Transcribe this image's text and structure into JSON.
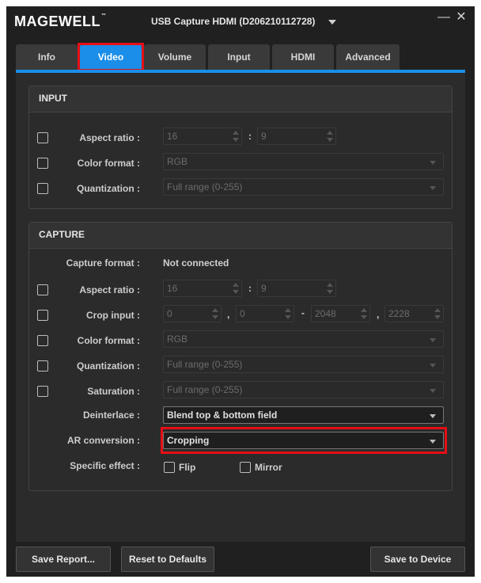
{
  "header": {
    "logo": "MAGEWELL",
    "logo_tm": "™",
    "device_name": "USB Capture HDMI (D206210112728)",
    "minimize": "—",
    "close": "✕"
  },
  "tabs": [
    {
      "label": "Info",
      "active": false
    },
    {
      "label": "Video",
      "active": true
    },
    {
      "label": "Volume",
      "active": false
    },
    {
      "label": "Input",
      "active": false
    },
    {
      "label": "HDMI",
      "active": false
    },
    {
      "label": "Advanced",
      "active": false
    }
  ],
  "input": {
    "title": "INPUT",
    "aspect_ratio": {
      "label": "Aspect ratio :",
      "width": "16",
      "separator": ":",
      "height": "9",
      "checked": false
    },
    "color_format": {
      "label": "Color format :",
      "value": "RGB",
      "checked": false
    },
    "quantization": {
      "label": "Quantization :",
      "value": "Full range (0-255)",
      "checked": false
    }
  },
  "capture": {
    "title": "CAPTURE",
    "capture_format": {
      "label": "Capture format :",
      "value": "Not connected"
    },
    "aspect_ratio": {
      "label": "Aspect ratio :",
      "width": "16",
      "separator": ":",
      "height": "9",
      "checked": false
    },
    "crop_input": {
      "label": "Crop input :",
      "x1": "0",
      "sep1": ",",
      "y1": "0",
      "sep2": "-",
      "x2": "2048",
      "sep3": ",",
      "y2": "2228",
      "checked": false
    },
    "color_format": {
      "label": "Color format :",
      "value": "RGB",
      "checked": false
    },
    "quantization": {
      "label": "Quantization :",
      "value": "Full range (0-255)",
      "checked": false
    },
    "saturation": {
      "label": "Saturation :",
      "value": "Full range (0-255)",
      "checked": false
    },
    "deinterlace": {
      "label": "Deinterlace :",
      "value": "Blend top & bottom field"
    },
    "ar_conversion": {
      "label": "AR conversion :",
      "value": "Cropping"
    },
    "specific_effect": {
      "label": "Specific effect :",
      "flip": "Flip",
      "mirror": "Mirror",
      "flip_checked": false,
      "mirror_checked": false
    }
  },
  "footer": {
    "save_report": "Save Report...",
    "reset_defaults": "Reset to Defaults",
    "save_device": "Save to Device"
  },
  "colors": {
    "accent": "#1a8ee8",
    "highlight": "#e60f16",
    "background": "#202020",
    "panel": "#2b2b2b"
  }
}
